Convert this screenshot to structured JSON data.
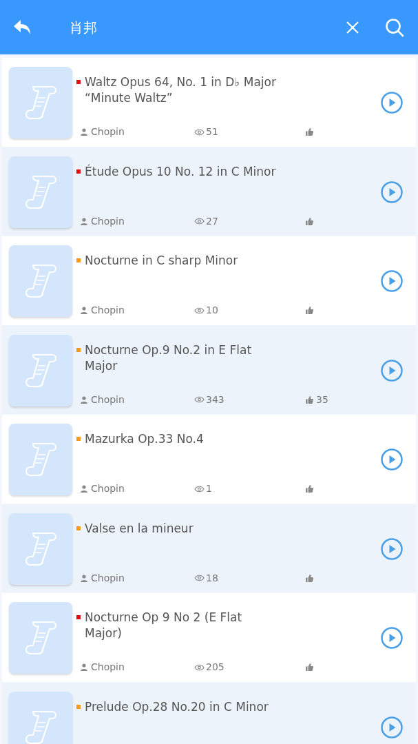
{
  "header": {
    "title": "肖邦"
  },
  "songs": [
    {
      "title": "Waltz Opus 64, No. 1 in D♭ Major\n“Minute Waltz”",
      "color": "#e01010",
      "author": "Chopin",
      "views": "51"
    },
    {
      "title": "Étude Opus 10 No. 12 in C Minor",
      "color": "#e01010",
      "author": "Chopin",
      "views": "27"
    },
    {
      "title": "Nocturne in C sharp Minor",
      "color": "#f59a1b",
      "author": "Chopin",
      "views": "10"
    },
    {
      "title": "Nocturne Op.9 No.2 in E Flat\nMajor",
      "color": "#f59a1b",
      "author": "Chopin",
      "views": "343",
      "likes": "35"
    },
    {
      "title": "Mazurka Op.33 No.4",
      "color": "#f59a1b",
      "author": "Chopin",
      "views": "1"
    },
    {
      "title": "Valse en la mineur",
      "color": "#f59a1b",
      "author": "Chopin",
      "views": "18"
    },
    {
      "title": "Nocturne Op 9 No 2 (E Flat\nMajor)",
      "color": "#e01010",
      "author": "Chopin",
      "views": "205"
    },
    {
      "title": "Prelude Op.28 No.20 in C Minor",
      "color": "#f59a1b"
    }
  ]
}
